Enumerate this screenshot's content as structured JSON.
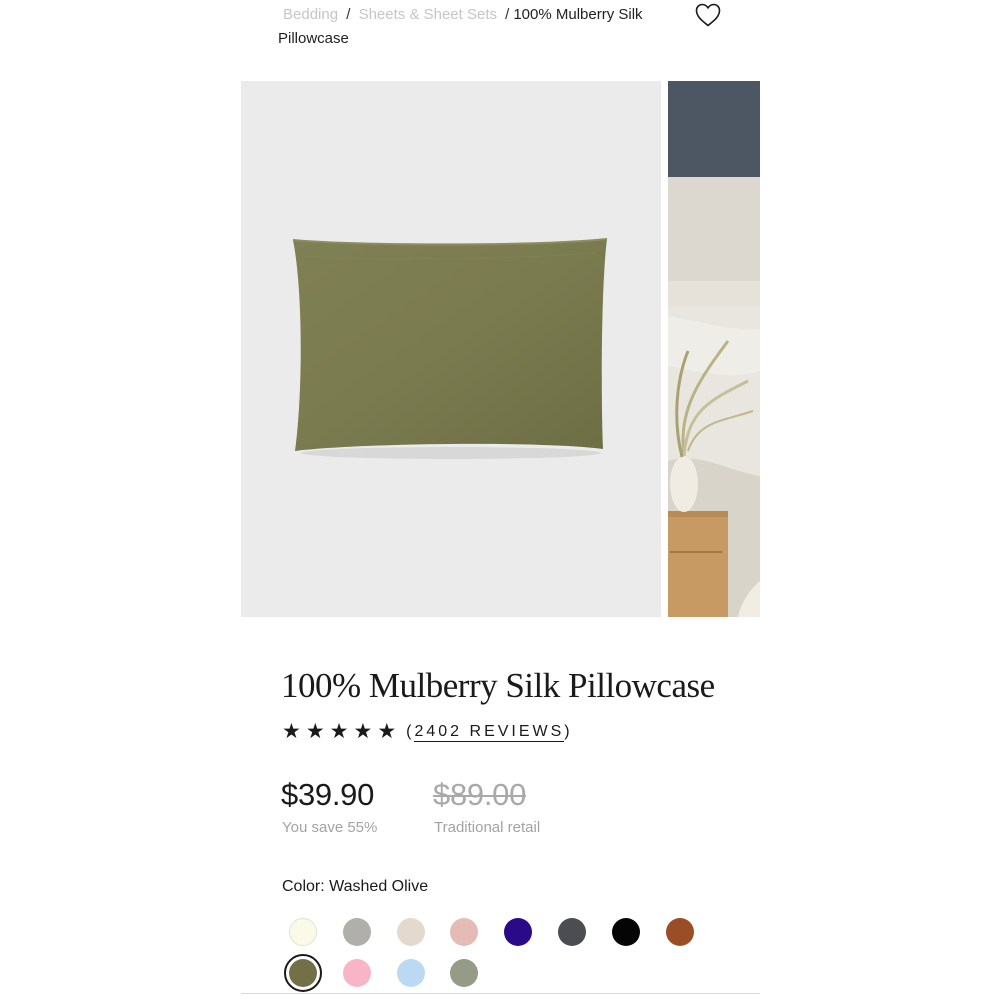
{
  "breadcrumb": {
    "items": [
      "Bedding",
      "Sheets & Sheet Sets"
    ],
    "separator": "/",
    "current": "100% Mulberry Silk Pillowcase"
  },
  "wishlist": {
    "icon": "heart-outline-icon"
  },
  "product": {
    "title": "100% Mulberry Silk Pillowcase",
    "rating_stars": "★",
    "rating": 5,
    "reviews_label": "(2402 REVIEWS)",
    "reviews_open": "(",
    "reviews_link": "2402 REVIEWS",
    "reviews_close": ")",
    "price": "$39.90",
    "savings": "You save 55%",
    "retail_price": "$89.00",
    "retail_label": "Traditional retail",
    "color_label": "Color: Washed Olive",
    "selected_color": "Washed Olive",
    "pillow_color": "#7a7b4f"
  },
  "swatches": [
    {
      "color": "#fafae9",
      "border": "#e2e2d2"
    },
    {
      "color": "#b0afab"
    },
    {
      "color": "#e3d9cc"
    },
    {
      "color": "#e4bcb5"
    },
    {
      "color": "#2b0a8a"
    },
    {
      "color": "#4c4d52"
    },
    {
      "color": "#050505"
    },
    {
      "color": "#9b4e25"
    },
    {
      "color": "#737048",
      "selected": true
    },
    {
      "color": "#f7b5c7"
    },
    {
      "color": "#bcd9f3"
    },
    {
      "color": "#949c85"
    }
  ]
}
